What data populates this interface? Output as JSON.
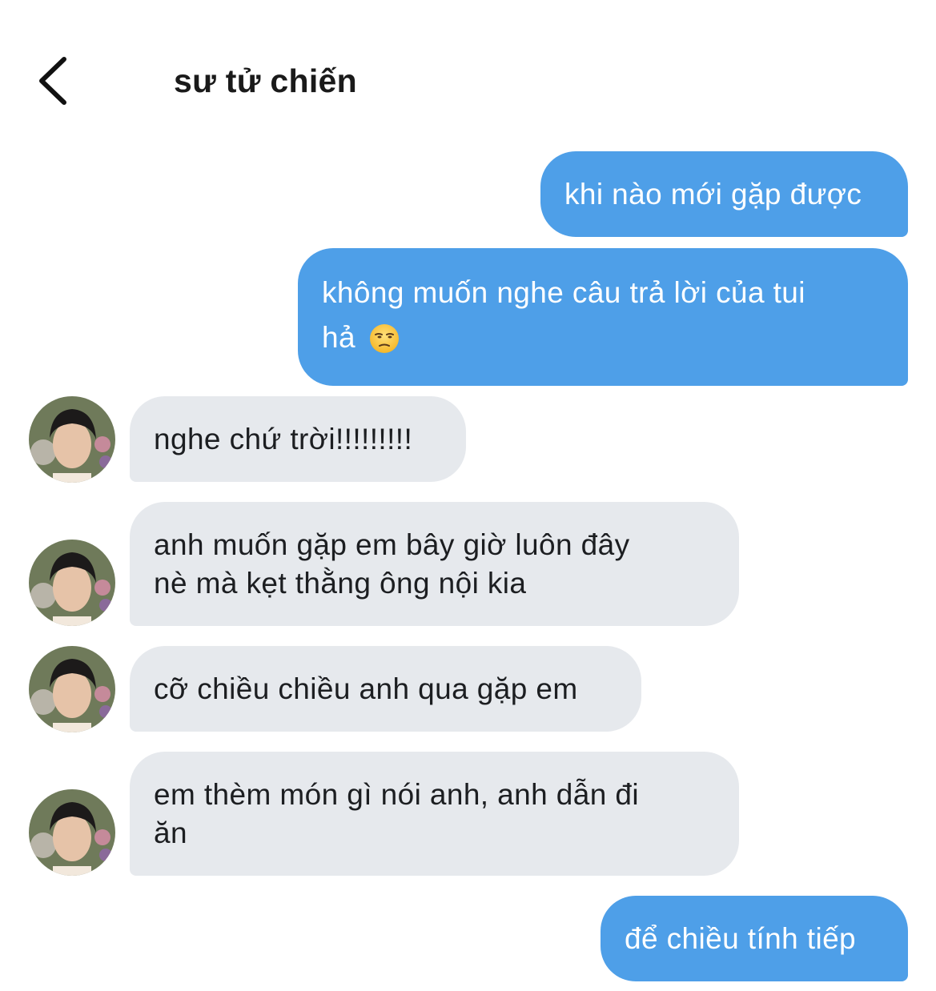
{
  "header": {
    "title": "sư tử chiến",
    "back_icon": "chevron-left-icon"
  },
  "messages": [
    {
      "from": "me",
      "text": "khi nào mới gặp được"
    },
    {
      "from": "me",
      "line1": "không muốn nghe câu trả lời của tui",
      "line2": "hả",
      "emoji": "unamused-face-icon"
    },
    {
      "from": "them",
      "text": "nghe chứ trời!!!!!!!!!"
    },
    {
      "from": "them",
      "line1": "anh muốn gặp em bây giờ luôn đây",
      "line2": "nè mà kẹt thằng ông nội kia"
    },
    {
      "from": "them",
      "text": "cỡ chiều chiều anh qua gặp em"
    },
    {
      "from": "them",
      "line1": "em thèm món gì nói anh, anh dẫn đi",
      "line2": "ăn"
    },
    {
      "from": "me",
      "text": "để chiều tính tiếp"
    }
  ],
  "colors": {
    "outgoing_bubble": "#4e9fe8",
    "incoming_bubble": "#e6e9ed",
    "background": "#ffffff"
  }
}
